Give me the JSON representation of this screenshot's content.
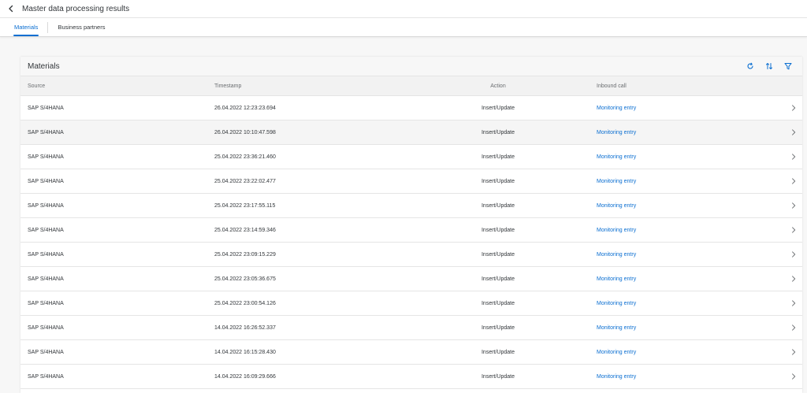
{
  "header": {
    "title": "Master data processing results",
    "back_icon": "chevron-left-icon"
  },
  "tabs": [
    {
      "label": "Materials",
      "active": true
    },
    {
      "label": "Business partners",
      "active": false
    }
  ],
  "table": {
    "title": "Materials",
    "toolbar": {
      "refresh_icon": "refresh-icon",
      "sort_icon": "sort-icon",
      "filter_icon": "filter-icon"
    },
    "columns": {
      "source": "Source",
      "timestamp": "Timestamp",
      "action": "Action",
      "inbound": "Inbound call"
    },
    "rows": [
      {
        "source": "SAP S/4HANA",
        "timestamp": "26.04.2022 12:23:23.694",
        "action": "Insert/Update",
        "inbound": "Monitoring entry"
      },
      {
        "source": "SAP S/4HANA",
        "timestamp": "26.04.2022 10:10:47.598",
        "action": "Insert/Update",
        "inbound": "Monitoring entry"
      },
      {
        "source": "SAP S/4HANA",
        "timestamp": "25.04.2022 23:36:21.460",
        "action": "Insert/Update",
        "inbound": "Monitoring entry"
      },
      {
        "source": "SAP S/4HANA",
        "timestamp": "25.04.2022 23:22:02.477",
        "action": "Insert/Update",
        "inbound": "Monitoring entry"
      },
      {
        "source": "SAP S/4HANA",
        "timestamp": "25.04.2022 23:17:55.115",
        "action": "Insert/Update",
        "inbound": "Monitoring entry"
      },
      {
        "source": "SAP S/4HANA",
        "timestamp": "25.04.2022 23:14:59.346",
        "action": "Insert/Update",
        "inbound": "Monitoring entry"
      },
      {
        "source": "SAP S/4HANA",
        "timestamp": "25.04.2022 23:09:15.229",
        "action": "Insert/Update",
        "inbound": "Monitoring entry"
      },
      {
        "source": "SAP S/4HANA",
        "timestamp": "25.04.2022 23:05:36.675",
        "action": "Insert/Update",
        "inbound": "Monitoring entry"
      },
      {
        "source": "SAP S/4HANA",
        "timestamp": "25.04.2022 23:00:54.126",
        "action": "Insert/Update",
        "inbound": "Monitoring entry"
      },
      {
        "source": "SAP S/4HANA",
        "timestamp": "14.04.2022 16:26:52.337",
        "action": "Insert/Update",
        "inbound": "Monitoring entry"
      },
      {
        "source": "SAP S/4HANA",
        "timestamp": "14.04.2022 16:15:28.430",
        "action": "Insert/Update",
        "inbound": "Monitoring entry"
      },
      {
        "source": "SAP S/4HANA",
        "timestamp": "14.04.2022 16:09:29.666",
        "action": "Insert/Update",
        "inbound": "Monitoring entry"
      }
    ]
  },
  "colors": {
    "accent": "#0a6ed1",
    "text": "#32363a",
    "muted": "#6a6d70"
  }
}
